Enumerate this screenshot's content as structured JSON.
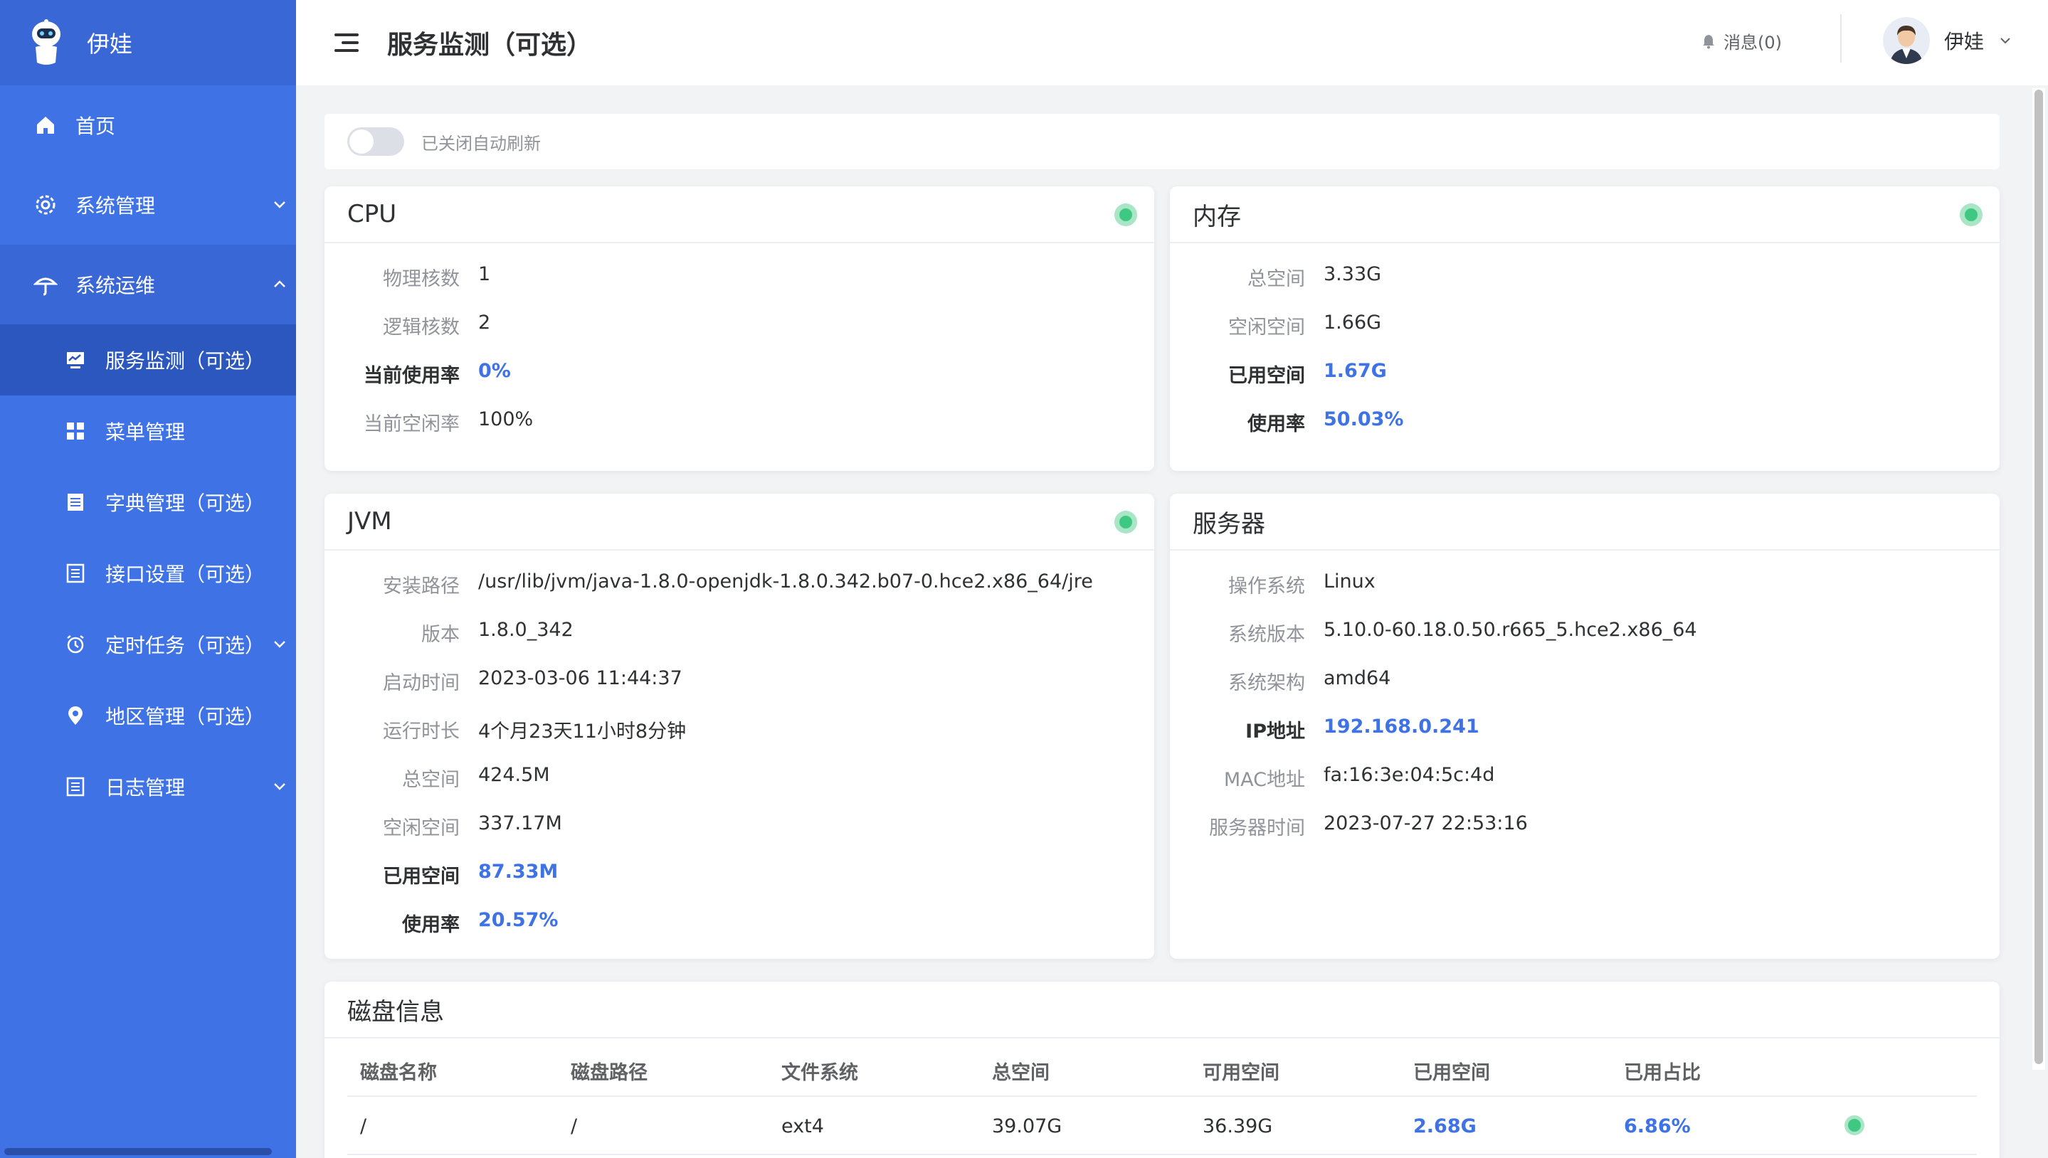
{
  "brand": {
    "name": "伊娃"
  },
  "sidebar": {
    "items": [
      {
        "label": "首页",
        "icon": "home-icon"
      },
      {
        "label": "系统管理",
        "icon": "gear-icon"
      },
      {
        "label": "系统运维",
        "icon": "umbrella-icon"
      }
    ],
    "submenu": [
      {
        "label": "服务监测（可选）",
        "icon": "monitor-icon",
        "active": true
      },
      {
        "label": "菜单管理",
        "icon": "grid-icon"
      },
      {
        "label": "字典管理（可选）",
        "icon": "list-icon"
      },
      {
        "label": "接口设置（可选）",
        "icon": "doc-icon"
      },
      {
        "label": "定时任务（可选）",
        "icon": "alarm-icon"
      },
      {
        "label": "地区管理（可选）",
        "icon": "location-icon"
      },
      {
        "label": "日志管理",
        "icon": "doc-icon"
      }
    ]
  },
  "header": {
    "title": "服务监测（可选）",
    "messages": "消息(0)",
    "user": "伊娃"
  },
  "toolbar": {
    "auto_refresh_label": "已关闭自动刷新"
  },
  "cpu": {
    "title": "CPU",
    "rows": [
      {
        "k": "物理核数",
        "v": "1"
      },
      {
        "k": "逻辑核数",
        "v": "2"
      },
      {
        "k": "当前使用率",
        "v": "0%"
      },
      {
        "k": "当前空闲率",
        "v": "100%"
      }
    ]
  },
  "memory": {
    "title": "内存",
    "rows": [
      {
        "k": "总空间",
        "v": "3.33G"
      },
      {
        "k": "空闲空间",
        "v": "1.66G"
      },
      {
        "k": "已用空间",
        "v": "1.67G"
      },
      {
        "k": "使用率",
        "v": "50.03%"
      }
    ]
  },
  "jvm": {
    "title": "JVM",
    "rows": [
      {
        "k": "安装路径",
        "v": "/usr/lib/jvm/java-1.8.0-openjdk-1.8.0.342.b07-0.hce2.x86_64/jre"
      },
      {
        "k": "版本",
        "v": "1.8.0_342"
      },
      {
        "k": "启动时间",
        "v": "2023-03-06 11:44:37"
      },
      {
        "k": "运行时长",
        "v": "4个月23天11小时8分钟"
      },
      {
        "k": "总空间",
        "v": "424.5M"
      },
      {
        "k": "空闲空间",
        "v": "337.17M"
      },
      {
        "k": "已用空间",
        "v": "87.33M"
      },
      {
        "k": "使用率",
        "v": "20.57%"
      }
    ]
  },
  "server": {
    "title": "服务器",
    "rows": [
      {
        "k": "操作系统",
        "v": "Linux"
      },
      {
        "k": "系统版本",
        "v": "5.10.0-60.18.0.50.r665_5.hce2.x86_64"
      },
      {
        "k": "系统架构",
        "v": "amd64"
      },
      {
        "k": "IP地址",
        "v": "192.168.0.241"
      },
      {
        "k": "MAC地址",
        "v": "fa:16:3e:04:5c:4d"
      },
      {
        "k": "服务器时间",
        "v": "2023-07-27 22:53:16"
      }
    ]
  },
  "disk": {
    "title": "磁盘信息",
    "columns": [
      "磁盘名称",
      "磁盘路径",
      "文件系统",
      "总空间",
      "可用空间",
      "已用空间",
      "已用占比"
    ],
    "rows": [
      [
        "/",
        "/",
        "ext4",
        "39.07G",
        "36.39G",
        "2.68G",
        "6.86%"
      ]
    ]
  },
  "colors": {
    "accent": "#3f73e5",
    "sidebar": "#3f73e5",
    "status_ok": "#3ec882"
  }
}
